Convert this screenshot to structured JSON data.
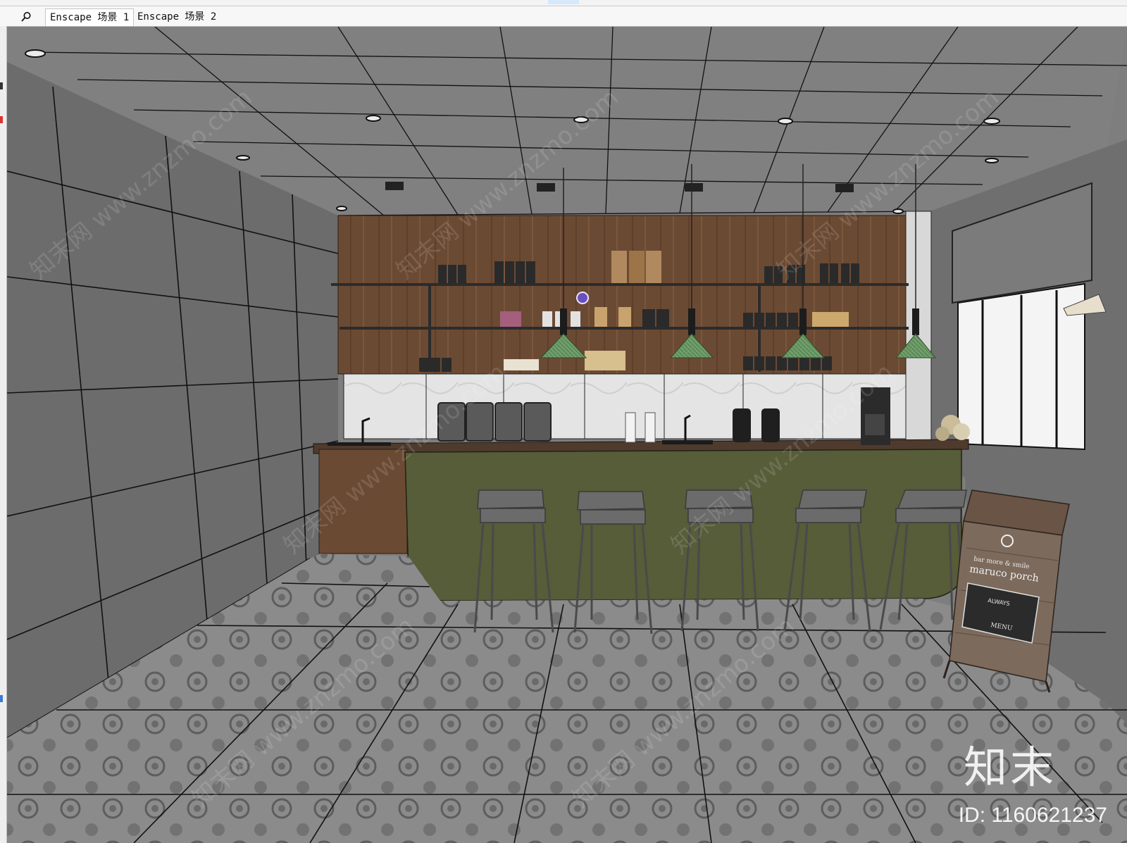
{
  "tabs": [
    {
      "label": "Enscape 场景 1"
    },
    {
      "label": "Enscape 场景 2"
    }
  ],
  "icons": {
    "search": "search-icon"
  },
  "scene": {
    "sign_lines": [
      "bar more & smile",
      "maruco porch",
      "ALWAYS",
      "MENU"
    ],
    "colors": {
      "wall": "#6e6e6e",
      "ceiling": "#808080",
      "wood": "#6b4a33",
      "counter": "#575c39",
      "lamp": "#6f9e6a",
      "floor": "#8a8a8a"
    }
  },
  "watermark": {
    "logo": "知末",
    "id": "ID: 1160621237",
    "diagonal_text": "知末网 www.znzmo.com"
  }
}
